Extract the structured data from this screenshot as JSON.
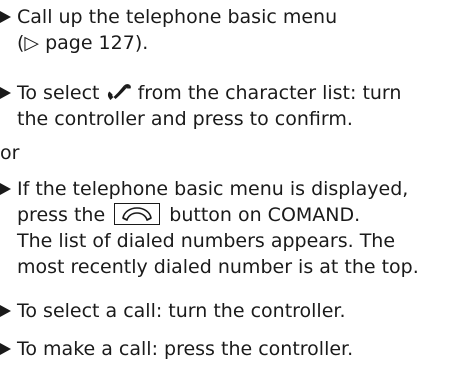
{
  "steps": [
    {
      "lines": [
        "Call up the telephone basic menu",
        "(▷ page 127)."
      ]
    },
    {
      "line1_before_icon": "To select",
      "line1_after_icon": "from the character list: turn",
      "line2": "the controller and press to confirm."
    },
    {
      "line1": "If the telephone basic menu is displayed,",
      "line2_before_icon": "press the",
      "line2_after_icon": "button on COMAND.",
      "line3": "The list of dialed numbers appears. The",
      "line4": "most recently dialed number is at the top."
    },
    {
      "lines": [
        "To select a call: turn the controller."
      ]
    },
    {
      "lines": [
        "To make a call: press the controller."
      ]
    }
  ],
  "or_label": "or",
  "icons": {
    "bullet": "triangle-right-bullet-icon",
    "handset": "phone-handset-icon",
    "phone_button": "phone-button-icon"
  },
  "colors": {
    "text": "#1a1a1a",
    "background": "#ffffff"
  }
}
